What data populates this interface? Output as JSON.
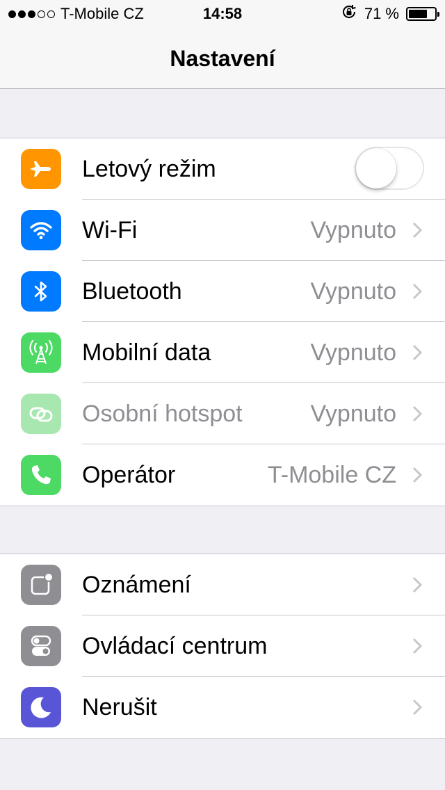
{
  "status_bar": {
    "carrier": "T-Mobile CZ",
    "signal_bars_filled": 3,
    "signal_bars_total": 5,
    "time": "14:58",
    "battery_percent": "71 %",
    "battery_level": 0.71
  },
  "nav": {
    "title": "Nastavení"
  },
  "groups": [
    {
      "rows": [
        {
          "label": "Letový režim",
          "value": "",
          "icon": "airplane-icon",
          "icon_color": "#ff9500",
          "control": "toggle",
          "toggle_on": false
        },
        {
          "label": "Wi-Fi",
          "value": "Vypnuto",
          "icon": "wifi-icon",
          "icon_color": "#007aff"
        },
        {
          "label": "Bluetooth",
          "value": "Vypnuto",
          "icon": "bluetooth-icon",
          "icon_color": "#007aff"
        },
        {
          "label": "Mobilní data",
          "value": "Vypnuto",
          "icon": "cellular-antenna-icon",
          "icon_color": "#4cd964"
        },
        {
          "label": "Osobní hotspot",
          "value": "Vypnuto",
          "icon": "hotspot-icon",
          "icon_color": "#a8e7b0",
          "disabled": true
        },
        {
          "label": "Operátor",
          "value": "T-Mobile CZ",
          "icon": "phone-icon",
          "icon_color": "#4cd964"
        }
      ]
    },
    {
      "rows": [
        {
          "label": "Oznámení",
          "value": "",
          "icon": "notifications-icon",
          "icon_color": "#8e8e93"
        },
        {
          "label": "Ovládací centrum",
          "value": "",
          "icon": "control-center-icon",
          "icon_color": "#8e8e93"
        },
        {
          "label": "Nerušit",
          "value": "",
          "icon": "moon-icon",
          "icon_color": "#5856d6"
        }
      ]
    }
  ]
}
